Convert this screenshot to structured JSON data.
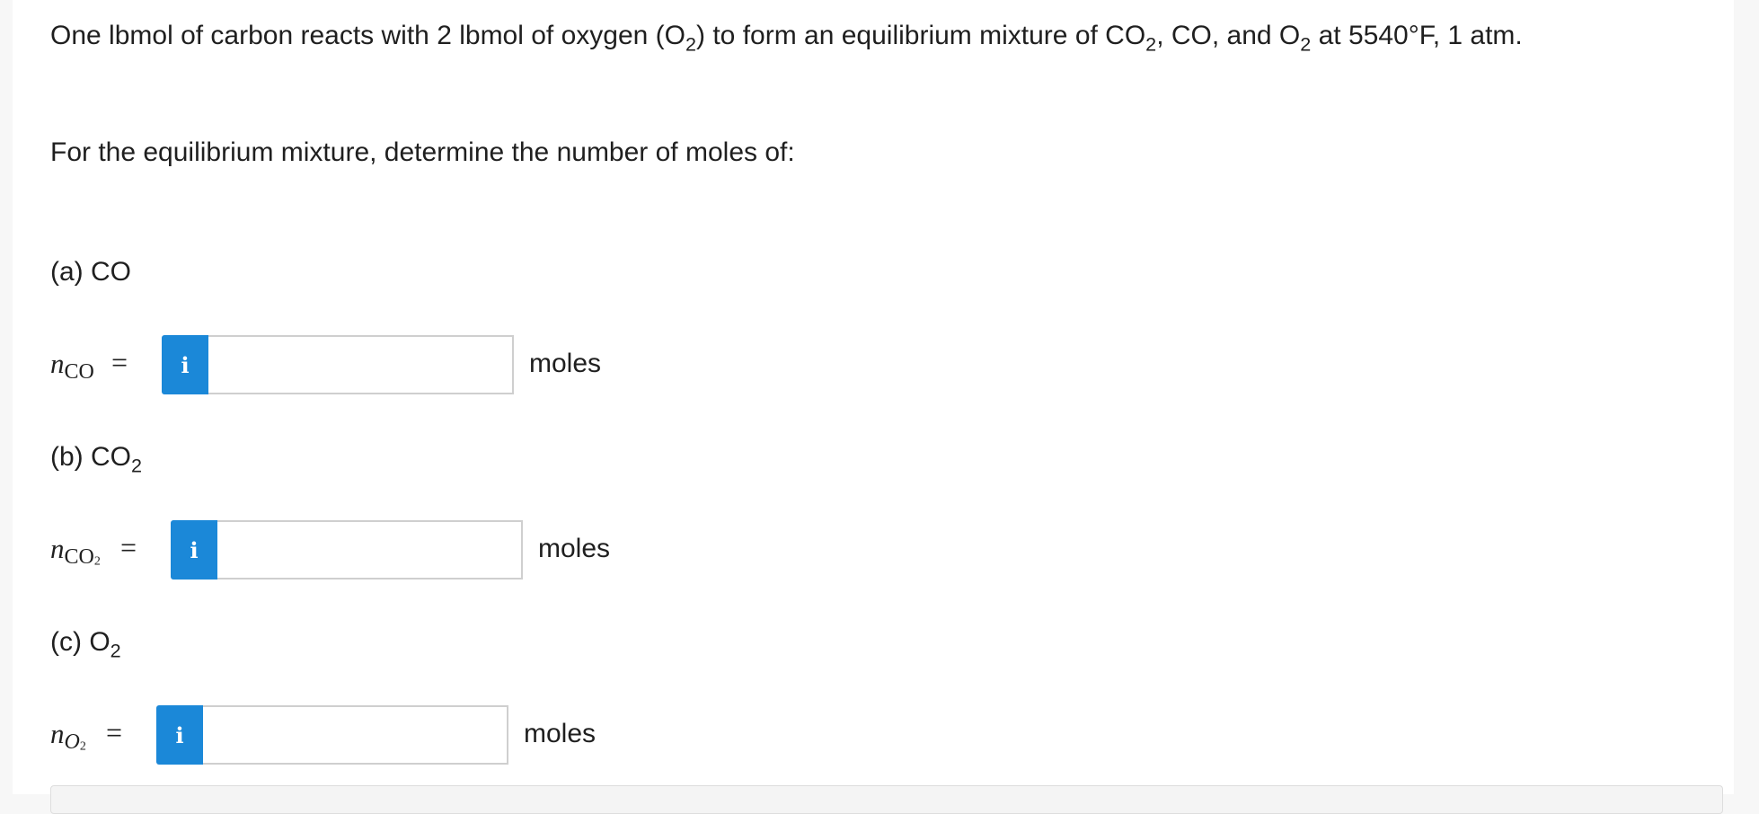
{
  "problem": {
    "statement_part1": "One lbmol of carbon reacts with 2 lbmol of oxygen (O",
    "statement_sub1": "2",
    "statement_part2": ") to form an equilibrium mixture of CO",
    "statement_sub2": "2",
    "statement_part3": ", CO, and O",
    "statement_sub3": "2",
    "statement_part4": " at 5540°F, 1 atm.",
    "instruction": "For the equilibrium mixture, determine the number of moles of:"
  },
  "parts": [
    {
      "heading": "(a) CO",
      "heading_sub": "",
      "var_symbol": "n",
      "var_subscript": "CO",
      "var_subscript_sub": "",
      "equals": "=",
      "info_icon": "i",
      "input_value": "",
      "units": "moles"
    },
    {
      "heading": "(b) CO",
      "heading_sub": "2",
      "var_symbol": "n",
      "var_subscript": "CO",
      "var_subscript_sub": "2",
      "equals": "=",
      "info_icon": "i",
      "input_value": "",
      "units": "moles"
    },
    {
      "heading": "(c) O",
      "heading_sub": "2",
      "var_symbol": "n",
      "var_subscript": "O",
      "var_subscript_sub": "2",
      "equals": "=",
      "info_icon": "i",
      "input_value": "",
      "units": "moles"
    }
  ],
  "colors": {
    "info_button": "#1b88d8",
    "text": "#1f1f1f",
    "input_border": "#cfcfcf"
  }
}
